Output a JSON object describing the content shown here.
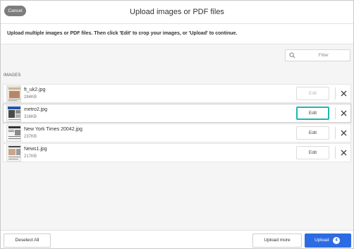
{
  "header": {
    "cancel_label": "Cancel",
    "title": "Upload images or PDF files"
  },
  "instructions": "Upload multiple images or PDF files. Then click 'Edit' to crop your images, or 'Upload' to continue.",
  "filter": {
    "placeholder": "Filter",
    "value": ""
  },
  "section_label": "IMAGES",
  "files": [
    {
      "name": "ft_uk2.jpg",
      "size": "284KB",
      "edit_label": "Edit",
      "edit_state": "disabled",
      "thumb_icon": "newspaper-thumbnail-icon"
    },
    {
      "name": "metro2.jpg",
      "size": "316KB",
      "edit_label": "Edit",
      "edit_state": "focused",
      "thumb_icon": "newspaper-thumbnail-icon"
    },
    {
      "name": "New York Times 20042.jpg",
      "size": "237KB",
      "edit_label": "Edit",
      "edit_state": "normal",
      "thumb_icon": "newspaper-thumbnail-icon"
    },
    {
      "name": "News1.jpg",
      "size": "217KB",
      "edit_label": "Edit",
      "edit_state": "normal",
      "thumb_icon": "newspaper-thumbnail-icon"
    }
  ],
  "footer": {
    "deselect_label": "Deselect All",
    "upload_more_label": "Upload more",
    "upload_label": "Upload",
    "upload_count": "4"
  },
  "colors": {
    "primary": "#2d6be3",
    "focus_ring": "#1fb5b5",
    "cancel_bg": "#7d7d7d"
  }
}
